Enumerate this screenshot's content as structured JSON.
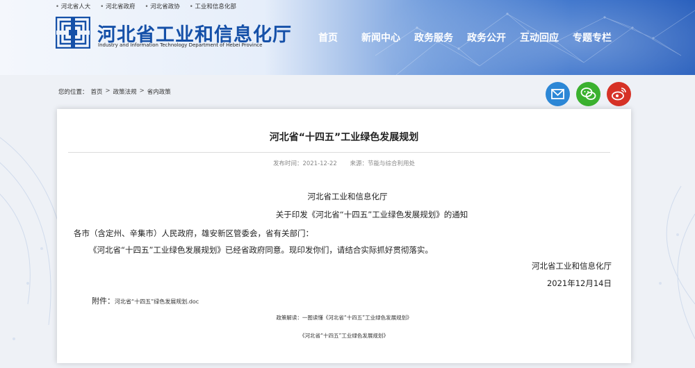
{
  "top_links": [
    "河北省人大",
    "河北省政府",
    "河北省政协",
    "工业和信息化部"
  ],
  "site": {
    "title": "河北省工业和信息化厅",
    "subtitle": "Industry and Information Technology Department of Hebei Province"
  },
  "nav": [
    "首页",
    "新闻中心",
    "政务服务",
    "政务公开",
    "互动回应",
    "专题专栏"
  ],
  "breadcrumb": {
    "label": "您的位置：",
    "items": [
      "首页",
      "政策法规",
      "省内政策"
    ],
    "separator": ">"
  },
  "share": {
    "icons": [
      "mail-icon",
      "wechat-icon",
      "weibo-icon"
    ],
    "colors": {
      "mail": "#2c87d6",
      "wechat": "#3bb12f",
      "weibo": "#d63226"
    }
  },
  "article": {
    "title": "河北省“十四五”工业绿色发展规划",
    "publish_time": "发布时间：2021-12-22",
    "source": "来源：节能与综合利用处",
    "issuer": "河北省工业和信息化厅",
    "notice_title": "关于印发《河北省“十四五”工业绿色发展规划》的通知",
    "addressee": "各市（含定州、辛集市）人民政府，雄安新区管委会，省有关部门：",
    "body": "《河北省“十四五”工业绿色发展规划》已经省政府同意。现印发你们，请结合实际抓好贯彻落实。",
    "signature": "河北省工业和信息化厅",
    "date": "2021年12月14日",
    "attachment_label": "附件：",
    "attachment_file": "河北省“十四五”绿色发展规划.doc",
    "policy_reading": "政策解读：一图读懂《河北省“十四五”工业绿色发展规划》",
    "policy_link": "《河北省“十四五”工业绿色发展规划》"
  },
  "colors": {
    "brand_blue": "#1550a8",
    "header_blue": "#1f5fc4"
  }
}
